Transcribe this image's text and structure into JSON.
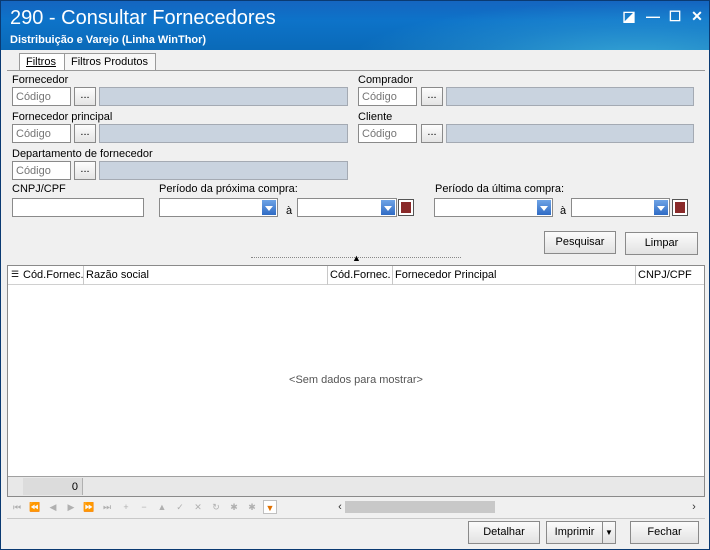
{
  "window": {
    "title": "290 - Consultar Fornecedores",
    "subtitle": "Distribuição e Varejo (Linha WinThor)",
    "buttons": {
      "restore": "◪",
      "minimize": "—",
      "maximize": "☐",
      "close": "✕"
    }
  },
  "tabs": [
    {
      "label": "Filtros"
    },
    {
      "label": "Filtros Produtos"
    }
  ],
  "filters": {
    "fornecedor": {
      "label": "Fornecedor",
      "code_placeholder": "Código",
      "lookup": "..."
    },
    "comprador": {
      "label": "Comprador",
      "code_placeholder": "Código",
      "lookup": "..."
    },
    "fornecedor_principal": {
      "label": "Fornecedor principal",
      "code_placeholder": "Código",
      "lookup": "..."
    },
    "cliente": {
      "label": "Cliente",
      "code_placeholder": "Código",
      "lookup": "..."
    },
    "departamento": {
      "label": "Departamento de fornecedor",
      "code_placeholder": "Código",
      "lookup": "..."
    },
    "cnpj": {
      "label": "CNPJ/CPF"
    },
    "proxima_compra": {
      "label": "Período da próxima compra:",
      "sep": "à"
    },
    "ultima_compra": {
      "label": "Período da última compra:",
      "sep": "à"
    }
  },
  "actions": {
    "pesquisar": "Pesquisar",
    "limpar": "Limpar"
  },
  "grid": {
    "columns": [
      "Cód.Fornec.",
      "Razão social",
      "Cód.Fornec.",
      "Fornecedor Principal",
      "CNPJ/CPF"
    ],
    "empty": "<Sem dados para mostrar>",
    "footer_count": "0"
  },
  "bottom": {
    "detalhar": "Detalhar",
    "imprimir": "Imprimir",
    "fechar": "Fechar"
  },
  "colors": {
    "titlebar": "#1565c0",
    "readonly": "#c9d3df"
  }
}
